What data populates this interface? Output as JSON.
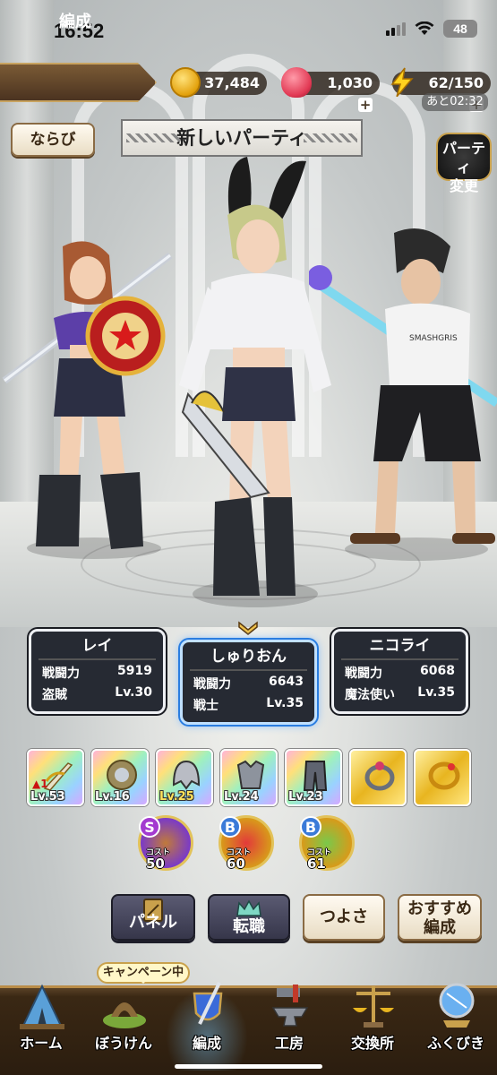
{
  "status_bar": {
    "time": "16:52",
    "battery": "48"
  },
  "header": {
    "screen_title": "編成",
    "gold": "37,484",
    "gems": "1,030",
    "stamina": "62/150",
    "stamina_timer": "あと02:32",
    "plus": "+"
  },
  "party": {
    "order_button": "ならび",
    "name": "新しいパーティ",
    "change_button_line1": "パーティ",
    "change_button_line2": "変更"
  },
  "cards": [
    {
      "name": "レイ",
      "power_label": "戦闘力",
      "power": "5919",
      "job": "盗賊",
      "level": "Lv.30"
    },
    {
      "name": "しゅりおん",
      "power_label": "戦闘力",
      "power": "6643",
      "job": "戦士",
      "level": "Lv.35"
    },
    {
      "name": "ニコライ",
      "power_label": "戦闘力",
      "power": "6068",
      "job": "魔法使い",
      "level": "Lv.35"
    }
  ],
  "equipment": [
    {
      "icon": "sword-icon",
      "level": "Lv.53",
      "mark": "▲1"
    },
    {
      "icon": "shield-icon",
      "level": "Lv.16"
    },
    {
      "icon": "helmet-icon",
      "level": "Lv.25"
    },
    {
      "icon": "armor-top-icon",
      "level": "Lv.24"
    },
    {
      "icon": "armor-bottom-icon",
      "level": "Lv.23"
    },
    {
      "icon": "ring-icon",
      "level": ""
    },
    {
      "icon": "bracelet-icon",
      "level": ""
    }
  ],
  "medals": [
    {
      "rank": "S",
      "cost_label": "コスト",
      "cost": "50"
    },
    {
      "rank": "B",
      "cost_label": "コスト",
      "cost": "60"
    },
    {
      "rank": "B",
      "cost_label": "コスト",
      "cost": "61"
    }
  ],
  "actions": {
    "panel": "パネル",
    "job_change": "転職",
    "strength": "つよさ",
    "recommend_line1": "おすすめ",
    "recommend_line2": "編成"
  },
  "nav": {
    "campaign_badge": "キャンペーン中",
    "items": [
      "ホーム",
      "ぼうけん",
      "編成",
      "工房",
      "交換所",
      "ふくびき"
    ],
    "active": "編成"
  },
  "colors": {
    "selected_card_glow": "#2a7de0",
    "nav_bg": "#2b1d0f",
    "gold_accent": "#c9a14c"
  }
}
